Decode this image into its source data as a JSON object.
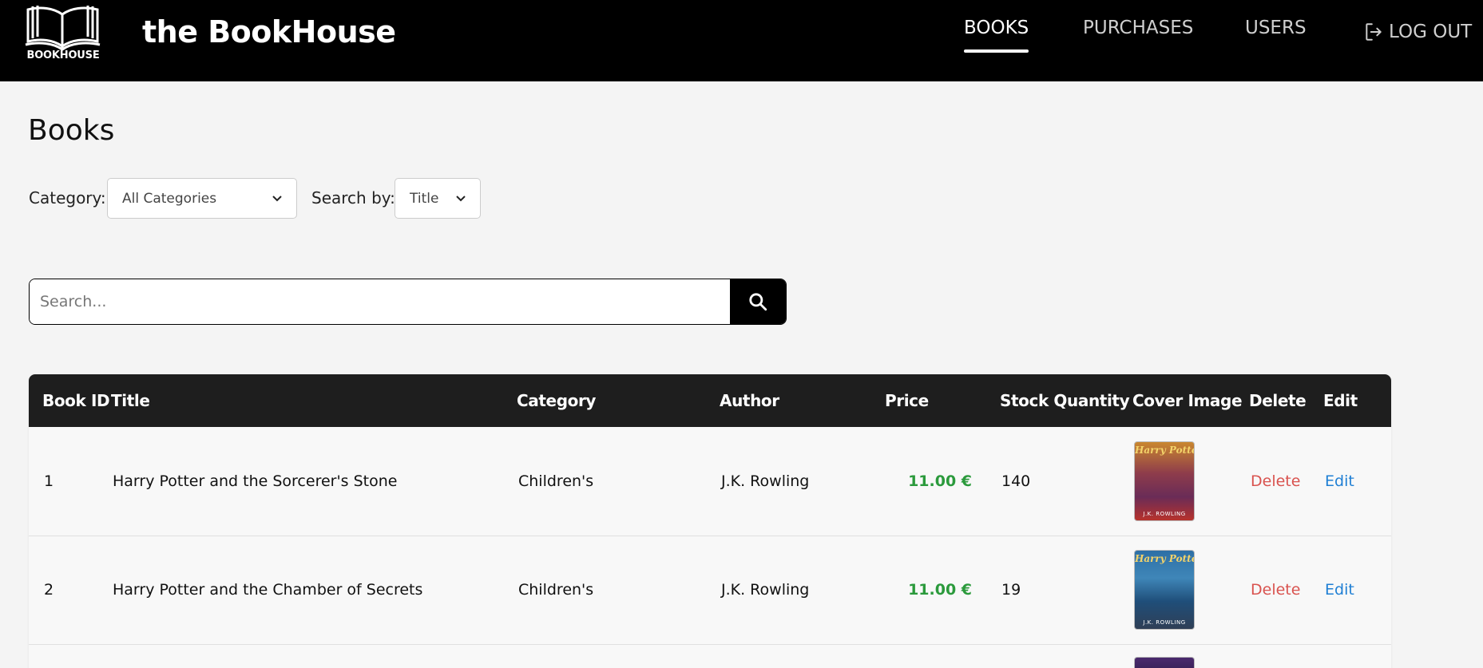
{
  "brand": {
    "logo_text": "BOOKHOUSE",
    "name": "the BookHouse"
  },
  "nav": {
    "items": [
      {
        "label": "BOOKS",
        "active": true
      },
      {
        "label": "PURCHASES",
        "active": false
      },
      {
        "label": "USERS",
        "active": false
      }
    ],
    "logout_label": "LOG OUT"
  },
  "page": {
    "title": "Books"
  },
  "filters": {
    "category_label": "Category:",
    "category_value": "All Categories",
    "searchby_label": "Search by:",
    "searchby_value": "Title"
  },
  "search": {
    "placeholder": "Search..."
  },
  "table": {
    "columns": [
      "Book ID",
      "Title",
      "Category",
      "Author",
      "Price",
      "Stock Quantity",
      "Cover Image",
      "Delete",
      "Edit"
    ],
    "rows": [
      {
        "id": "1",
        "title": "Harry Potter and the Sorcerer's Stone",
        "category": "Children's",
        "author": "J.K. Rowling",
        "price": "11.00 €",
        "stock": "140",
        "cover_title": "Harry Potter",
        "cover_author": "J.K. ROWLING",
        "delete_label": "Delete",
        "edit_label": "Edit"
      },
      {
        "id": "2",
        "title": "Harry Potter and the Chamber of Secrets",
        "category": "Children's",
        "author": "J.K. Rowling",
        "price": "11.00 €",
        "stock": "19",
        "cover_title": "Harry Potter",
        "cover_author": "J.K. ROWLING",
        "delete_label": "Delete",
        "edit_label": "Edit"
      }
    ]
  },
  "colors": {
    "price": "#2b9a3c",
    "delete": "#d9534f",
    "edit": "#1f7fd4",
    "header_bg": "#000000",
    "table_header_bg": "#1e1e1e"
  }
}
